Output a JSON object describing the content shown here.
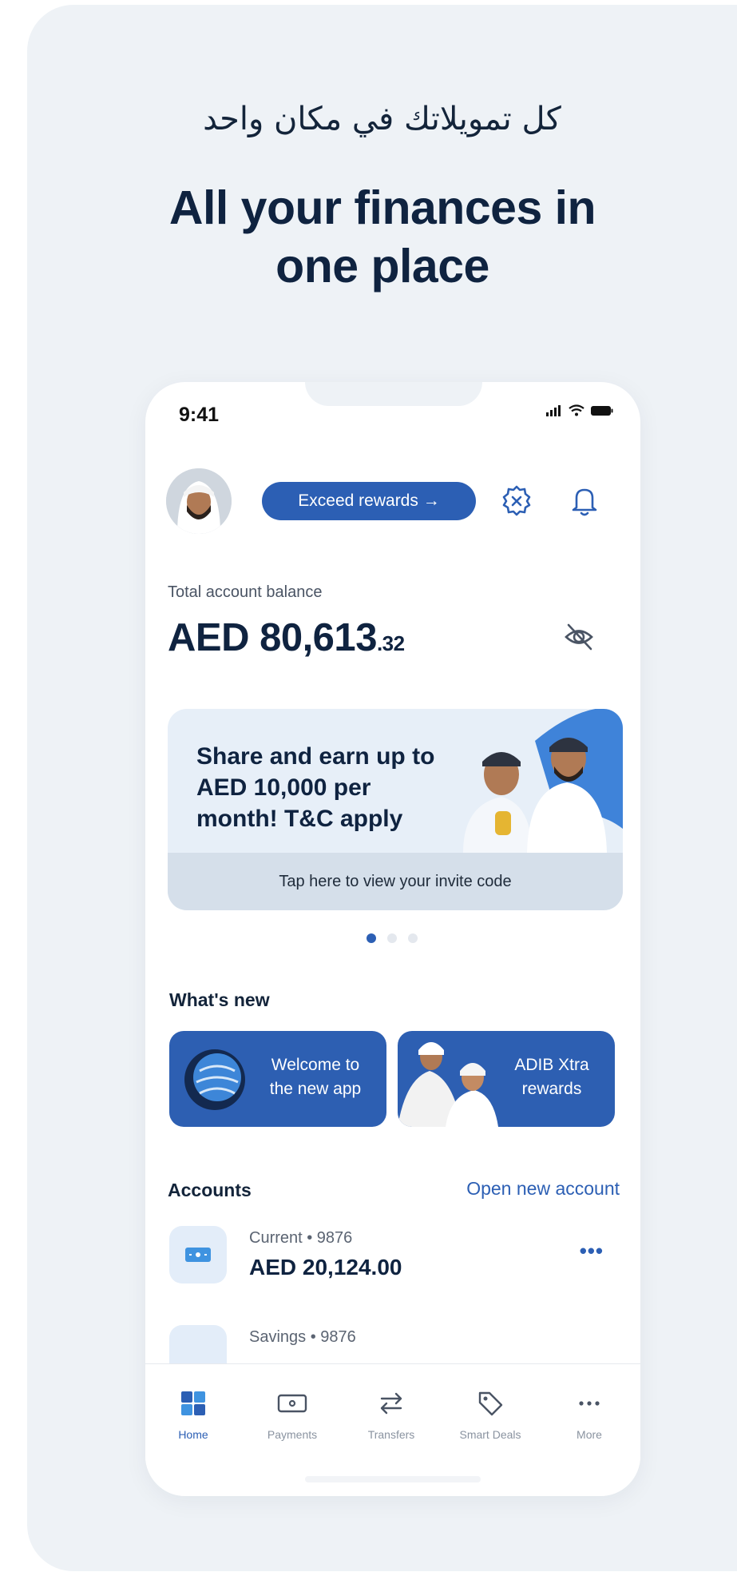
{
  "hero": {
    "arabic_title": "كل تمويلاتك في مكان واحد",
    "english_title": "All your finances in one place"
  },
  "status_bar": {
    "time": "9:41"
  },
  "header": {
    "rewards_label": "Exceed rewards →"
  },
  "balance": {
    "label": "Total account balance",
    "amount_main": "AED 80,613",
    "amount_cents": ".32"
  },
  "promo": {
    "text": "Share and earn up to AED 10,000 per month! T&C apply",
    "footer": "Tap here to view your invite code",
    "carousel_active_index": 0,
    "carousel_count": 3
  },
  "whats_new": {
    "title": "What's new",
    "tiles": [
      {
        "label": "Welcome to the new app"
      },
      {
        "label": "ADIB Xtra rewards"
      }
    ]
  },
  "accounts": {
    "title": "Accounts",
    "open_new": "Open new account",
    "items": [
      {
        "subtitle": "Current • 9876",
        "amount": "AED 20,124.00",
        "more": "•••"
      },
      {
        "subtitle": "Savings • 9876"
      }
    ]
  },
  "tabs": [
    {
      "label": "Home",
      "icon": "home-icon",
      "active": true
    },
    {
      "label": "Payments",
      "icon": "payments-icon",
      "active": false
    },
    {
      "label": "Transfers",
      "icon": "transfers-icon",
      "active": false
    },
    {
      "label": "Smart Deals",
      "icon": "tag-icon",
      "active": false
    },
    {
      "label": "More",
      "icon": "more-icon",
      "active": false
    }
  ],
  "colors": {
    "primary": "#2c5fb4",
    "heading": "#0f2340",
    "background": "#eef2f6"
  }
}
